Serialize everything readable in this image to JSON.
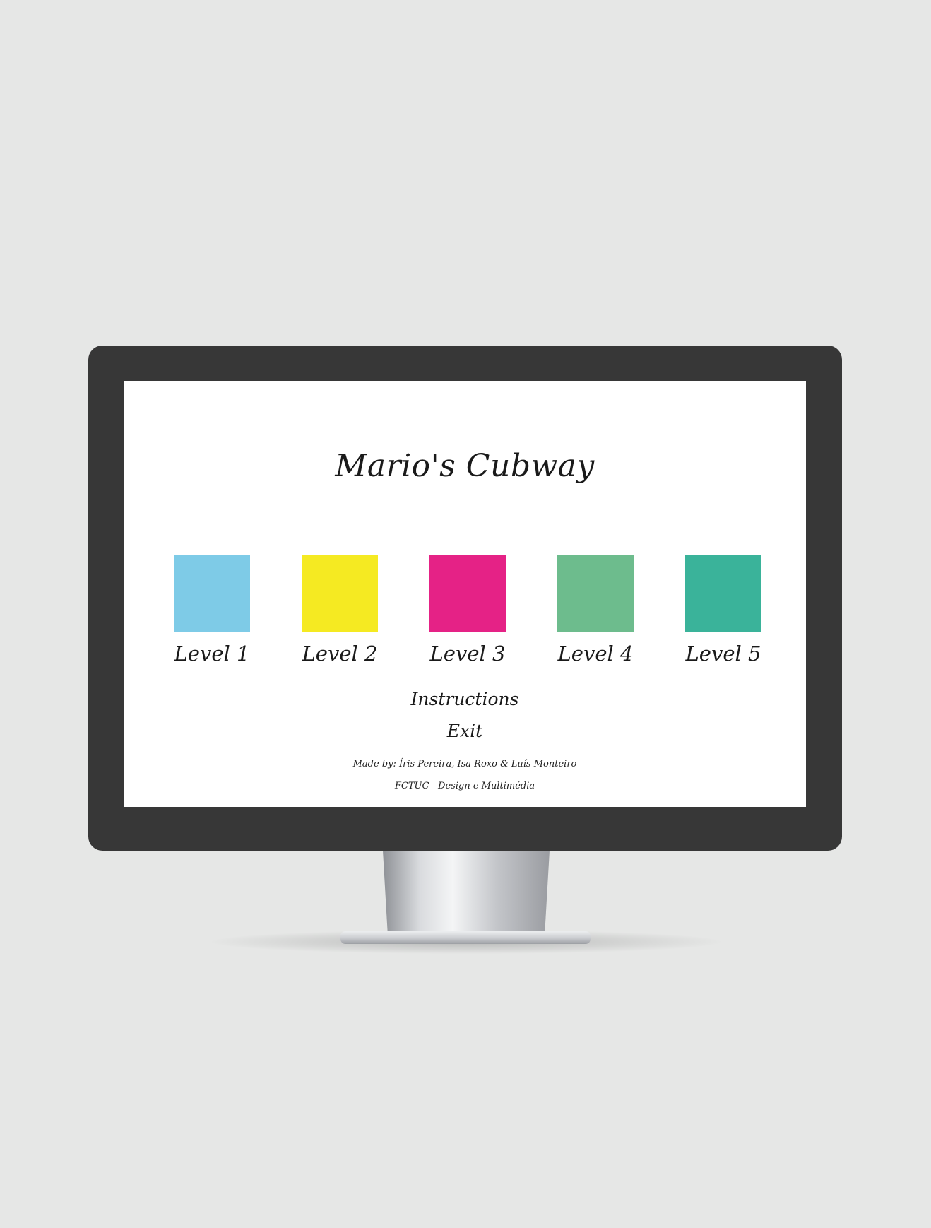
{
  "game": {
    "title": "Mario's Cubway"
  },
  "levels": [
    {
      "label": "Level 1",
      "color": "#7ecbe7"
    },
    {
      "label": "Level 2",
      "color": "#f5ea22"
    },
    {
      "label": "Level 3",
      "color": "#e52286"
    },
    {
      "label": "Level 4",
      "color": "#6dbc8d"
    },
    {
      "label": "Level 5",
      "color": "#3ab39a"
    }
  ],
  "menu": {
    "instructions_label": "Instructions",
    "exit_label": "Exit"
  },
  "credits": {
    "authors": "Made by: Íris Pereira, Isa Roxo & Luís Monteiro",
    "institution": "FCTUC - Design e Multimédia"
  },
  "colors": {
    "background": "#e6e7e6",
    "bezel": "#373737",
    "screen": "#ffffff",
    "text": "#1a1a1a"
  }
}
